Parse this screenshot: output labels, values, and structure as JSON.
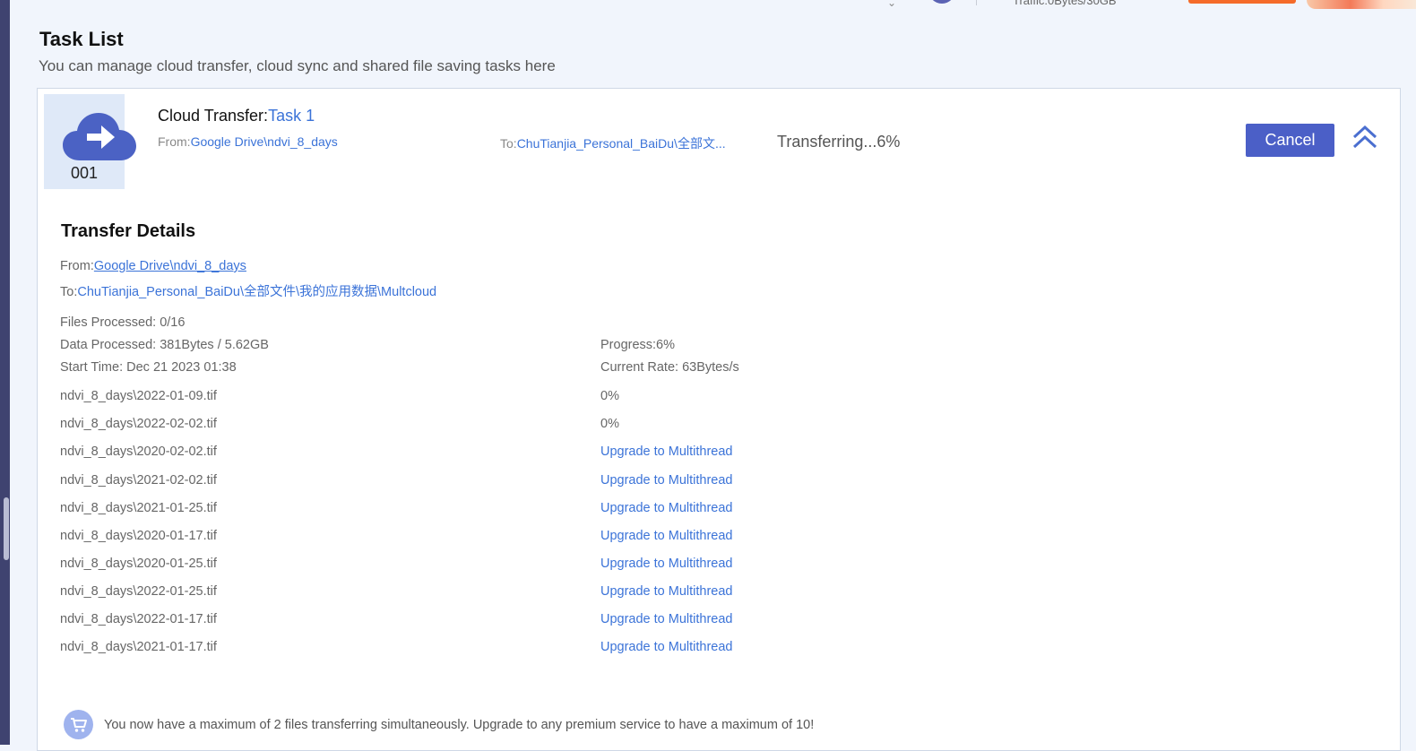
{
  "header": {
    "traffic": "Traffic:0Bytes/30GB"
  },
  "page": {
    "title": "Task List",
    "subtitle": "You can manage cloud transfer, cloud sync and shared file saving tasks here"
  },
  "task": {
    "number": "001",
    "type_label": "Cloud Transfer:",
    "name": "Task 1",
    "from_label": "From:",
    "from_path": "Google Drive\\ndvi_8_days",
    "to_label": "To:",
    "to_path_short": "ChuTianjia_Personal_BaiDu\\全部文...",
    "status": "Transferring...6%",
    "cancel_label": "Cancel"
  },
  "details": {
    "title": "Transfer Details",
    "from_label": "From:",
    "from_path": "Google Drive\\ndvi_8_days",
    "to_label": "To:",
    "to_path": "ChuTianjia_Personal_BaiDu\\全部文件\\我的应用数据\\Multcloud",
    "files_processed": "Files Processed: 0/16",
    "data_processed": "Data Processed: 381Bytes / 5.62GB",
    "start_time": "Start Time: Dec 21 2023 01:38",
    "progress": "Progress:6%",
    "current_rate": "Current Rate: 63Bytes/s"
  },
  "files": [
    {
      "name": "ndvi_8_days\\2022-01-09.tif",
      "status": "0%",
      "upgrade": false
    },
    {
      "name": "ndvi_8_days\\2022-02-02.tif",
      "status": "0%",
      "upgrade": false
    },
    {
      "name": "ndvi_8_days\\2020-02-02.tif",
      "status": "Upgrade to Multithread",
      "upgrade": true
    },
    {
      "name": "ndvi_8_days\\2021-02-02.tif",
      "status": "Upgrade to Multithread",
      "upgrade": true
    },
    {
      "name": "ndvi_8_days\\2021-01-25.tif",
      "status": "Upgrade to Multithread",
      "upgrade": true
    },
    {
      "name": "ndvi_8_days\\2020-01-17.tif",
      "status": "Upgrade to Multithread",
      "upgrade": true
    },
    {
      "name": "ndvi_8_days\\2020-01-25.tif",
      "status": "Upgrade to Multithread",
      "upgrade": true
    },
    {
      "name": "ndvi_8_days\\2022-01-25.tif",
      "status": "Upgrade to Multithread",
      "upgrade": true
    },
    {
      "name": "ndvi_8_days\\2022-01-17.tif",
      "status": "Upgrade to Multithread",
      "upgrade": true
    },
    {
      "name": "ndvi_8_days\\2021-01-17.tif",
      "status": "Upgrade to Multithread",
      "upgrade": true
    }
  ],
  "notice": {
    "text": "You now have a maximum of 2 files transferring simultaneously. Upgrade to any premium service to have a maximum of 10!"
  },
  "colors": {
    "accent": "#4b5fc7",
    "link": "#3b73d8",
    "sidebar": "#3f4370",
    "upgrade_orange": "#f56b2a"
  },
  "icons": [
    "cloud-transfer-icon",
    "collapse-chevron-icon",
    "cart-icon",
    "user-avatar-icon"
  ]
}
